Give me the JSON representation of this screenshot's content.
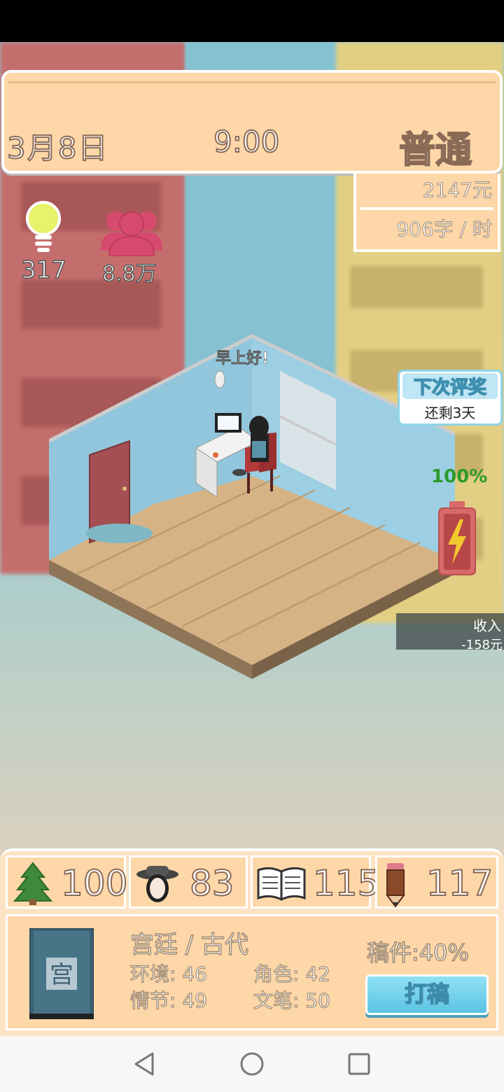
{
  "header": {
    "date": "3月8日",
    "time": "9:00",
    "difficulty": "普通"
  },
  "finance": {
    "money": "2147元",
    "speed": "906字 / 时"
  },
  "resources": {
    "ideas": "317",
    "fans": "8.8万"
  },
  "room": {
    "greeting": "早上好!"
  },
  "award": {
    "title": "下次评奖",
    "remaining": "还剩3天"
  },
  "energy": {
    "percent_label": "100%",
    "level": 1.0
  },
  "income": {
    "label": "收入",
    "value": "-158元"
  },
  "stats": [
    {
      "icon": "tree-icon",
      "value": "100"
    },
    {
      "icon": "character-icon",
      "value": "83"
    },
    {
      "icon": "book-open-icon",
      "value": "115"
    },
    {
      "icon": "pencil-icon",
      "value": "117"
    }
  ],
  "novel": {
    "genre": "宫廷 / 古代",
    "env_label": "环境: 46",
    "role_label": "角色: 42",
    "plot_label": "情节: 49",
    "style_label": "文笔: 50",
    "progress": "稿件:40%",
    "draft_button": "打稿",
    "book_label": "宫"
  },
  "colors": {
    "panel": "#fdd7a8",
    "accent_button": "#5cc4e2",
    "fans": "#d64a6e",
    "idea": "#e8f26a"
  }
}
